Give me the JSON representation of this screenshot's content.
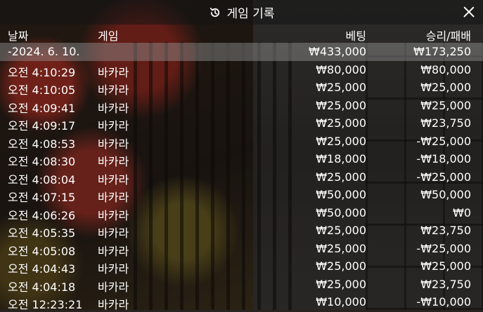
{
  "header": {
    "title": "게임 기록"
  },
  "columns": {
    "date": "날짜",
    "game": "게임",
    "bet": "베팅",
    "winloss": "승리/패배"
  },
  "summary": {
    "date": "-2024. 6. 10.",
    "bet": "₩433,000",
    "winloss": "₩173,250"
  },
  "rows": [
    {
      "time": "오전 4:10:29",
      "game": "바카라",
      "bet": "₩80,000",
      "winloss": "₩80,000"
    },
    {
      "time": "오전 4:10:05",
      "game": "바카라",
      "bet": "₩25,000",
      "winloss": "₩25,000"
    },
    {
      "time": "오전 4:09:41",
      "game": "바카라",
      "bet": "₩25,000",
      "winloss": "₩25,000"
    },
    {
      "time": "오전 4:09:17",
      "game": "바카라",
      "bet": "₩25,000",
      "winloss": "₩23,750"
    },
    {
      "time": "오전 4:08:53",
      "game": "바카라",
      "bet": "₩25,000",
      "winloss": "-₩25,000"
    },
    {
      "time": "오전 4:08:30",
      "game": "바카라",
      "bet": "₩18,000",
      "winloss": "-₩18,000"
    },
    {
      "time": "오전 4:08:04",
      "game": "바카라",
      "bet": "₩25,000",
      "winloss": "-₩25,000"
    },
    {
      "time": "오전 4:07:15",
      "game": "바카라",
      "bet": "₩50,000",
      "winloss": "₩50,000"
    },
    {
      "time": "오전 4:06:26",
      "game": "바카라",
      "bet": "₩50,000",
      "winloss": "₩0"
    },
    {
      "time": "오전 4:05:35",
      "game": "바카라",
      "bet": "₩25,000",
      "winloss": "₩23,750"
    },
    {
      "time": "오전 4:05:08",
      "game": "바카라",
      "bet": "₩25,000",
      "winloss": "-₩25,000"
    },
    {
      "time": "오전 4:04:43",
      "game": "바카라",
      "bet": "₩25,000",
      "winloss": "₩25,000"
    },
    {
      "time": "오전 4:04:18",
      "game": "바카라",
      "bet": "₩25,000",
      "winloss": "₩23,750"
    },
    {
      "time": "오전 12:23:21",
      "game": "바카라",
      "bet": "₩10,000",
      "winloss": "-₩10,000"
    }
  ],
  "icons": {
    "history": "history-icon",
    "close": "close-icon"
  }
}
